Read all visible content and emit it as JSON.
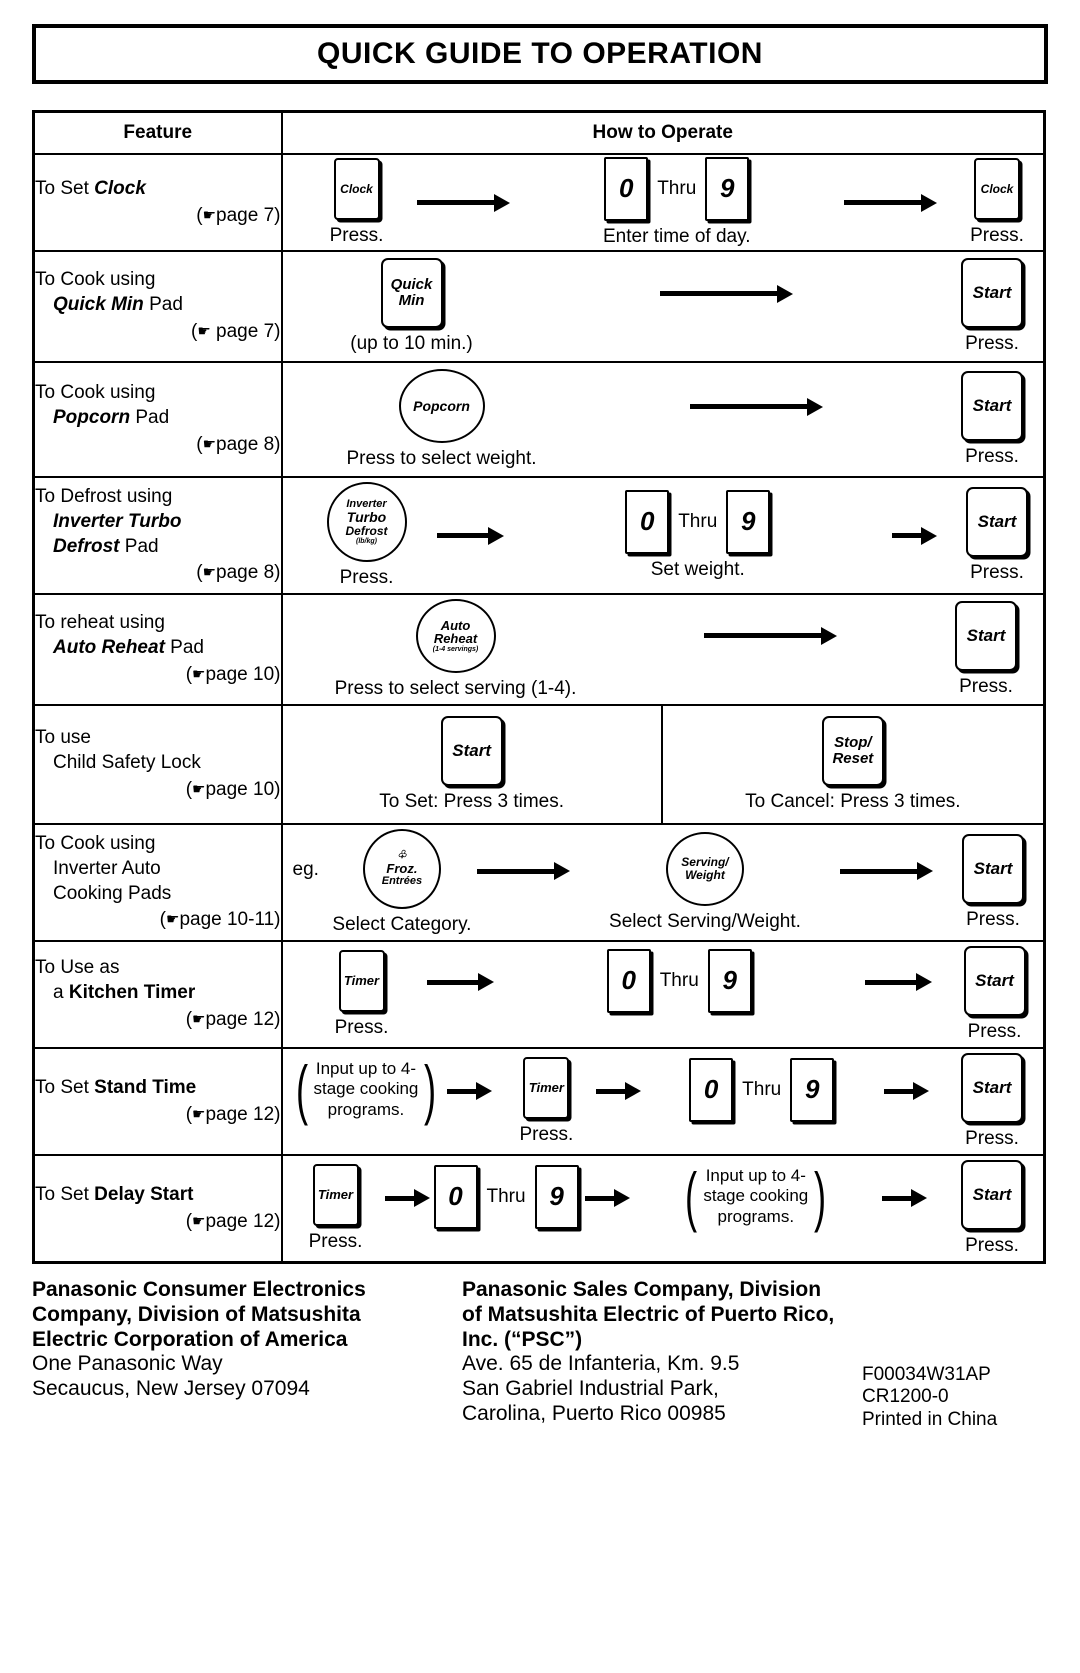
{
  "title": "QUICK GUIDE TO OPERATION",
  "table": {
    "headers": {
      "feature": "Feature",
      "how_to_operate": "How to Operate"
    },
    "rows": [
      {
        "feature_lines": [
          "To Set ",
          "Clock"
        ],
        "feature_plain": "To Set",
        "feature_em": "Clock",
        "page_ref": "page 7",
        "steps": {
          "pad1": "Clock",
          "pad1_caption": "Press.",
          "digit_low": "0",
          "thru": "Thru",
          "digit_high": "9",
          "digits_caption": "Enter time of day.",
          "pad2": "Clock",
          "pad2_caption": "Press."
        }
      },
      {
        "feature_l1": "To Cook using",
        "feature_em": "Quick Min",
        "feature_l2_tail": " Pad",
        "page_ref": "page 7",
        "steps": {
          "pad1_l1": "Quick",
          "pad1_l2": "Min",
          "pad1_caption": "(up to 10 min.)",
          "start": "Start",
          "start_caption": "Press."
        }
      },
      {
        "feature_l1": "To Cook using",
        "feature_em": "Popcorn",
        "feature_l2_tail": " Pad",
        "page_ref": "page 8",
        "steps": {
          "pad1": "Popcorn",
          "pad1_caption": "Press to select weight.",
          "start": "Start",
          "start_caption": "Press."
        }
      },
      {
        "feature_l1": "To Defrost using",
        "feature_em1": "Inverter Turbo",
        "feature_em2": "Defrost",
        "feature_l3_tail": " Pad",
        "page_ref": "page 8",
        "steps": {
          "pad1_l1": "Inverter",
          "pad1_l2": "Turbo",
          "pad1_l3": "Defrost",
          "pad1_sub": "(lb/kg)",
          "pad1_caption": "Press.",
          "digit_low": "0",
          "thru": "Thru",
          "digit_high": "9",
          "digits_caption": "Set weight.",
          "start": "Start",
          "start_caption": "Press."
        }
      },
      {
        "feature_l1": "To reheat using",
        "feature_em": "Auto Reheat",
        "feature_l2_tail": " Pad",
        "page_ref": "page 10",
        "steps": {
          "pad1_l1": "Auto",
          "pad1_l2": "Reheat",
          "pad1_sub": "(1-4 servings)",
          "pad1_caption": "Press to select serving (1-4).",
          "start": "Start",
          "start_caption": "Press."
        }
      },
      {
        "feature_l1": "To use",
        "feature_l2": "Child Safety Lock",
        "page_ref": "page 10",
        "steps": {
          "left_pad": "Start",
          "left_caption": "To Set: Press 3 times.",
          "right_pad_l1": "Stop/",
          "right_pad_l2": "Reset",
          "right_caption": "To Cancel: Press 3 times."
        }
      },
      {
        "feature_l1": "To Cook using",
        "feature_l2": "Inverter Auto",
        "feature_l3": "Cooking Pads",
        "page_ref": "page 10-11",
        "steps": {
          "eg": "eg.",
          "pad1_l1": "Froz.",
          "pad1_l2": "Entrées",
          "pad1_caption": "Select Category.",
          "pad2_l1": "Serving/",
          "pad2_l2": "Weight",
          "pad2_caption": "Select Serving/Weight.",
          "start": "Start",
          "start_caption": "Press."
        }
      },
      {
        "feature_l1": "To Use as",
        "feature_l2_head": "a ",
        "feature_em": "Kitchen Timer",
        "page_ref": "page 12",
        "steps": {
          "pad1": "Timer",
          "pad1_caption": "Press.",
          "digit_low": "0",
          "thru": "Thru",
          "digit_high": "9",
          "start": "Start",
          "start_caption": "Press."
        }
      },
      {
        "feature_l1_head": "To Set ",
        "feature_em": "Stand Time",
        "page_ref": "page 12",
        "steps": {
          "brace_l1": "Input up to 4-",
          "brace_l2": "stage cooking",
          "brace_l3": "programs.",
          "pad1": "Timer",
          "pad1_caption": "Press.",
          "digit_low": "0",
          "thru": "Thru",
          "digit_high": "9",
          "start": "Start",
          "start_caption": "Press."
        }
      },
      {
        "feature_l1_head": "To Set ",
        "feature_em": "Delay Start",
        "page_ref": "page 12",
        "steps": {
          "pad1": "Timer",
          "pad1_caption": "Press.",
          "digit_low": "0",
          "thru": "Thru",
          "digit_high": "9",
          "brace_l1": "Input up to 4-",
          "brace_l2": "stage cooking",
          "brace_l3": "programs.",
          "start": "Start",
          "start_caption": "Press."
        }
      }
    ]
  },
  "footer": {
    "col1": {
      "b1": "Panasonic Consumer Electronics",
      "b2": "Company, Division of Matsushita",
      "b3": "Electric Corporation of America",
      "n1": "One Panasonic Way",
      "n2": "Secaucus, New Jersey 07094"
    },
    "col2": {
      "b1": "Panasonic Sales Company, Division",
      "b2": "of Matsushita Electric of Puerto Rico,",
      "b3": "Inc. (“PSC”)",
      "n1": "Ave. 65 de Infanteria, Km. 9.5",
      "n2": "San Gabriel Industrial Park,",
      "n3": "Carolina, Puerto Rico 00985"
    },
    "col3": {
      "c1": "F00034W31AP",
      "c2": "CR1200-0",
      "c3": "Printed in China"
    }
  }
}
